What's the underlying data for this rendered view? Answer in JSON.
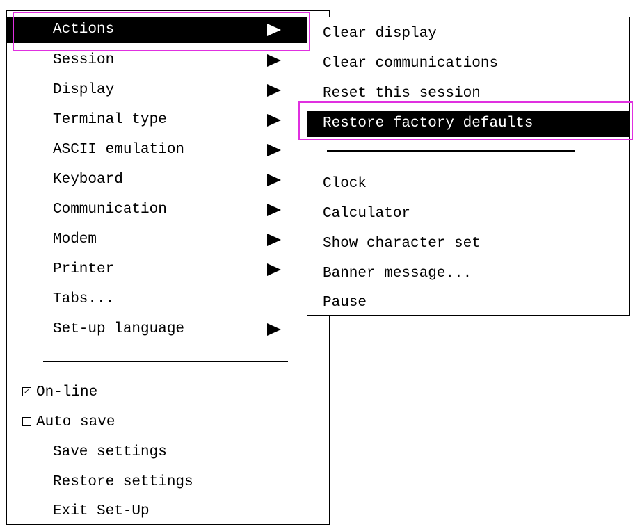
{
  "main_menu": {
    "items": [
      {
        "label": "Actions"
      },
      {
        "label": "Session"
      },
      {
        "label": "Display"
      },
      {
        "label": "Terminal type"
      },
      {
        "label": "ASCII emulation"
      },
      {
        "label": "Keyboard"
      },
      {
        "label": "Communication"
      },
      {
        "label": "Modem"
      },
      {
        "label": "Printer"
      },
      {
        "label": "Tabs..."
      },
      {
        "label": "Set-up language"
      }
    ],
    "toggles": [
      {
        "label": "On-line",
        "checked": true,
        "mark": "✓"
      },
      {
        "label": "Auto save",
        "checked": false,
        "mark": ""
      }
    ],
    "commands": [
      {
        "label": "Save settings"
      },
      {
        "label": "Restore settings"
      },
      {
        "label": "Exit Set-Up"
      }
    ]
  },
  "actions_submenu": {
    "items": [
      {
        "label": "Clear display"
      },
      {
        "label": "Clear communications"
      },
      {
        "label": "Reset this session"
      },
      {
        "label": "Restore factory defaults"
      }
    ],
    "tools": [
      {
        "label": "Clock"
      },
      {
        "label": "Calculator"
      },
      {
        "label": "Show character set"
      },
      {
        "label": "Banner message..."
      },
      {
        "label": "Pause"
      }
    ]
  },
  "colors": {
    "highlight_outline": "#e030e0",
    "selected_background": "#000000",
    "selected_text": "#ffffff"
  }
}
